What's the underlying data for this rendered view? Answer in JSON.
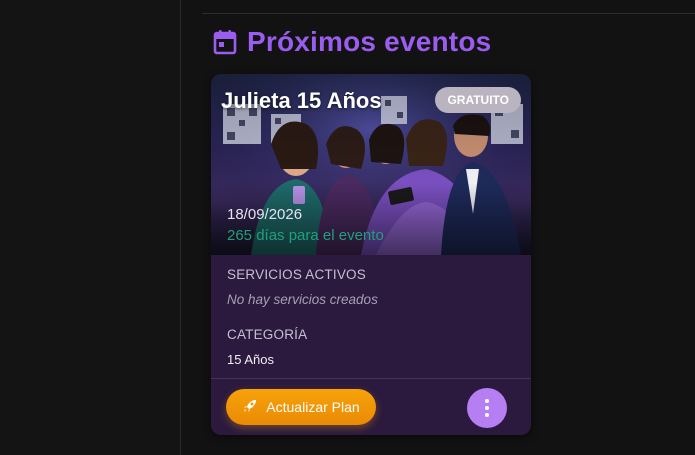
{
  "section": {
    "title": "Próximos eventos",
    "icon": "calendar-icon",
    "accent_color": "#9b5cf0"
  },
  "event_card": {
    "title": "Julieta 15 Años",
    "badge": "GRATUITO",
    "date": "18/09/2026",
    "countdown": "265 días para el evento",
    "services_label": "SERVICIOS ACTIVOS",
    "services_value": "No hay servicios creados",
    "category_label": "CATEGORÍA",
    "category_value": "15 Años",
    "upgrade_button": "Actualizar Plan",
    "upgrade_icon": "rocket-icon",
    "more_icon": "more-vertical-icon",
    "upgrade_color": "#f59e0b",
    "more_color": "#b57ef2"
  }
}
